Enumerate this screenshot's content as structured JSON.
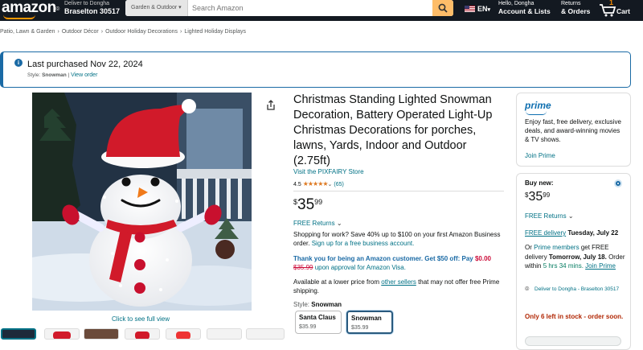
{
  "nav": {
    "logo": "amazon",
    "deliver_line1": "Deliver to Dongha",
    "deliver_line2": "Braselton 30517",
    "search_category": "Garden & Outdoor",
    "search_placeholder": "Search Amazon",
    "lang": "EN",
    "account_line1": "Hello, Dongha",
    "account_line2": "Account & Lists",
    "orders_line1": "Returns",
    "orders_line2": "& Orders",
    "cart_count": "1",
    "cart_label": "Cart"
  },
  "breadcrumb": [
    "Patio, Lawn & Garden",
    "Outdoor Décor",
    "Outdoor Holiday Decorations",
    "Lighted Holiday Displays"
  ],
  "banner": {
    "title": "Last purchased Nov 22, 2024",
    "style_prefix": "Style: ",
    "style_value": "Snowman",
    "divider": " | ",
    "link": "View order"
  },
  "gallery": {
    "full_view": "Click to see full view"
  },
  "product": {
    "title": "Christmas Standing Lighted Snowman Decoration, Battery Operated Light-Up Christmas Decorations for porches, lawns, Yards, Indoor and Outdoor (2.75ft)",
    "store": "Visit the PIXFAIRY Store",
    "rating": "4.5",
    "stars": "★★★★★",
    "review_count": "(65)",
    "price_symbol": "$",
    "price_whole": "35",
    "price_cents": "99",
    "free_returns": "FREE Returns",
    "business_text": "Shopping for work? Save 40% up to $100 on your first Amazon Business order.",
    "business_link": "Sign up for a free business account.",
    "card_offer_blue": "Thank you for being an Amazon customer. Get $50 off: Pay",
    "card_offer_price": "$0.00",
    "card_offer_strike": "$35.99",
    "card_offer_tail": "upon approval for Amazon Visa.",
    "lower_price_a": "Available at a lower price from",
    "lower_price_link": "other sellers",
    "lower_price_b": "that may not offer free Prime shipping.",
    "style_label": "Style:",
    "style_value": "Snowman",
    "styles": [
      {
        "name": "Santa Claus",
        "price": "$35.99"
      },
      {
        "name": "Snowman",
        "price": "$35.99"
      }
    ]
  },
  "prime": {
    "logo": "prime",
    "text": "Enjoy fast, free delivery, exclusive deals, and award-winning movies & TV shows.",
    "join": "Join Prime"
  },
  "buybox": {
    "label": "Buy new:",
    "price_symbol": "$",
    "price_whole": "35",
    "price_cents": "99",
    "free_returns": "FREE Returns",
    "free_delivery_link": "FREE delivery",
    "free_delivery_date": "Tuesday, July 22",
    "fast_or": "Or",
    "fast_link": "Prime members",
    "fast_text": "get FREE delivery",
    "fast_date": "Tomorrow, July 18.",
    "fast_within": "Order within",
    "fast_timer": "5 hrs 34 mins.",
    "fast_join": "Join Prime",
    "location": "Deliver to Dongha - Braselton 30517",
    "stock": "Only 6 left in stock - order soon."
  },
  "colors": {
    "nav_bg": "#131921",
    "link": "#007185",
    "accent": "#febd69",
    "prime_blue": "#0f6fb0",
    "stock_red": "#b12704",
    "delivery_green": "#067d62"
  }
}
